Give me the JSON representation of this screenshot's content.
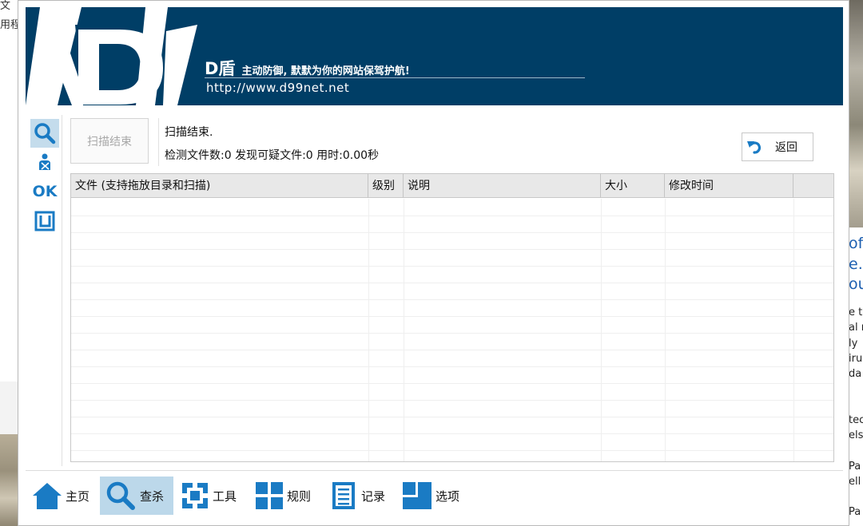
{
  "background": {
    "left_snippets": [
      "文",
      "用程"
    ],
    "right_snippets_large": [
      "of",
      "e.",
      "ou"
    ],
    "right_snippets_small": [
      "e t",
      "al r",
      "ly",
      "iru",
      "da",
      "tec",
      "els",
      "Pa",
      "ell",
      "Pa"
    ]
  },
  "banner": {
    "brand": "D盾",
    "slogan": "主动防御, 默默为你的网站保驾护航!",
    "url": "http://www.d99net.net",
    "logo_letter": "D"
  },
  "sidebar": {
    "items": [
      {
        "name": "scan",
        "icon": "magnifier-icon",
        "active": true
      },
      {
        "name": "user-kill",
        "icon": "person-cross-icon",
        "active": false
      },
      {
        "name": "ok",
        "icon": "ok-icon",
        "label": "OK",
        "active": false
      },
      {
        "name": "frame",
        "icon": "frame-icon",
        "active": false
      }
    ]
  },
  "controls": {
    "scan_end_label": "扫描结束",
    "status_text": "扫描结束.",
    "stats_text": "检测文件数:0 发现可疑文件:0 用时:0.00秒",
    "back_label": "返回"
  },
  "table": {
    "columns": [
      "文件 (支持拖放目录和扫描)",
      "级别",
      "说明",
      "大小",
      "修改时间",
      ""
    ],
    "rows": []
  },
  "bottom_nav": {
    "items": [
      {
        "label": "主页",
        "icon": "home-icon",
        "active": false
      },
      {
        "label": "查杀",
        "icon": "search-icon",
        "active": true
      },
      {
        "label": "工具",
        "icon": "tools-icon",
        "active": false
      },
      {
        "label": "规则",
        "icon": "rules-icon",
        "active": false
      },
      {
        "label": "记录",
        "icon": "log-icon",
        "active": false
      },
      {
        "label": "选项",
        "icon": "options-icon",
        "active": false
      }
    ]
  },
  "colors": {
    "banner_bg": "#003e66",
    "active_tab": "#bcd8ea",
    "icon_blue": "#1a7bc4"
  }
}
